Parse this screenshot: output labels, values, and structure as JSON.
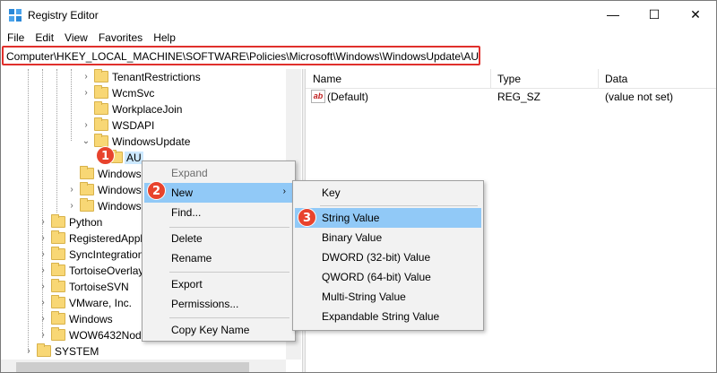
{
  "window": {
    "title": "Registry Editor",
    "minimize_glyph": "—",
    "maximize_glyph": "☐",
    "close_glyph": "✕"
  },
  "menu": [
    "File",
    "Edit",
    "View",
    "Favorites",
    "Help"
  ],
  "address": {
    "path": "Computer\\HKEY_LOCAL_MACHINE\\SOFTWARE\\Policies\\Microsoft\\Windows\\WindowsUpdate\\AU",
    "highlight_color": "#e0302c"
  },
  "tree": [
    {
      "label": "TenantRestrictions",
      "chevron": "›"
    },
    {
      "label": "WcmSvc",
      "chevron": "›"
    },
    {
      "label": "WorkplaceJoin",
      "chevron": ""
    },
    {
      "label": "WSDAPI",
      "chevron": "›"
    },
    {
      "label": "WindowsUpdate",
      "chevron": "⌄"
    },
    {
      "label": "AU",
      "chevron": "",
      "selected": true
    },
    {
      "label": "Windows",
      "chevron": ""
    },
    {
      "label": "Windows",
      "chevron": "›"
    },
    {
      "label": "Windows",
      "chevron": "›"
    },
    {
      "label": "Python",
      "chevron": "›"
    },
    {
      "label": "RegisteredAppl",
      "chevron": "›"
    },
    {
      "label": "SyncIntegration",
      "chevron": "›"
    },
    {
      "label": "TortoiseOverlay",
      "chevron": "›"
    },
    {
      "label": "TortoiseSVN",
      "chevron": "›"
    },
    {
      "label": "VMware, Inc.",
      "chevron": "›"
    },
    {
      "label": "Windows",
      "chevron": "›"
    },
    {
      "label": "WOW6432Nod",
      "chevron": "›"
    },
    {
      "label": "SYSTEM",
      "chevron": "›"
    }
  ],
  "list": {
    "columns": [
      "Name",
      "Type",
      "Data"
    ],
    "rows": [
      {
        "icon": "ab",
        "name": "(Default)",
        "type": "REG_SZ",
        "data": "(value not set)"
      }
    ]
  },
  "context_menu": {
    "items": [
      {
        "label": "Expand",
        "disabled": true
      },
      {
        "label": "New",
        "submenu_arrow": "›",
        "highlighted": true
      },
      {
        "label": "Find..."
      },
      {
        "label": "Delete"
      },
      {
        "label": "Rename"
      },
      {
        "label": "Export"
      },
      {
        "label": "Permissions..."
      },
      {
        "label": "Copy Key Name"
      }
    ]
  },
  "new_submenu": {
    "items": [
      {
        "label": "Key"
      },
      {
        "label": "String Value",
        "highlighted": true
      },
      {
        "label": "Binary Value"
      },
      {
        "label": "DWORD (32-bit) Value"
      },
      {
        "label": "QWORD (64-bit) Value"
      },
      {
        "label": "Multi-String Value"
      },
      {
        "label": "Expandable String Value"
      }
    ]
  },
  "steps": [
    "1",
    "2",
    "3"
  ],
  "colors": {
    "step_badge": "#e8432d",
    "menu_highlight": "#91c9f7",
    "selection": "#cce8ff"
  }
}
